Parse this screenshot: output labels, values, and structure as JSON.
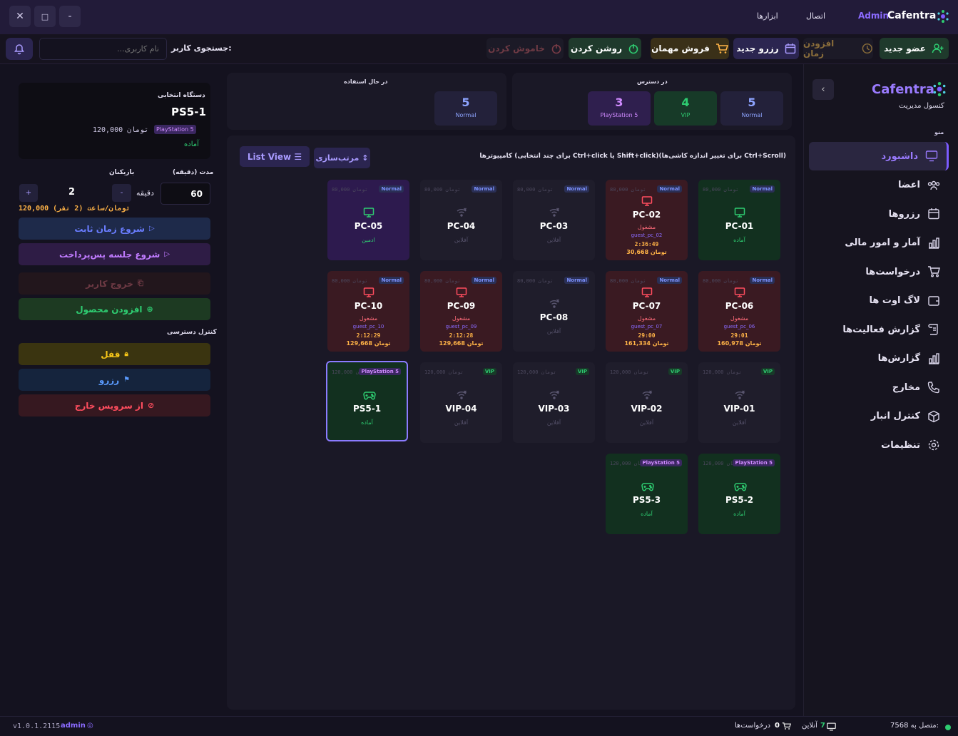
{
  "titlebar": {
    "brand": "Cafentra",
    "brand_admin": "Admin",
    "menu_connect": "اتصال",
    "menu_tools": "ابزارها",
    "btn_min": "-",
    "btn_max": "□",
    "btn_close": "✕"
  },
  "toolbar": {
    "new_member": "عضو جدید",
    "add_time": "افزودن زمان",
    "new_reserve": "رزرو جدید",
    "guest_sale": "فروش مهمان",
    "turn_on": "روشن کردن",
    "turn_off": "خاموش کردن",
    "search_label": "جستجوی کاربر:",
    "search_placeholder": "نام کاربری..."
  },
  "sidebar": {
    "brand": "Cafentra",
    "subtitle": "کنسول مدیریت",
    "menu_title": "منو",
    "collapse": "‹",
    "items": [
      {
        "label": "داشبورد",
        "icon": "monitor-icon"
      },
      {
        "label": "اعضا",
        "icon": "users-icon"
      },
      {
        "label": "رزروها",
        "icon": "calendar-icon"
      },
      {
        "label": "آمار و امور مالی",
        "icon": "chart-icon"
      },
      {
        "label": "درخواست‌ها",
        "icon": "cart-icon"
      },
      {
        "label": "لاگ اوت ها",
        "icon": "wallet-icon"
      },
      {
        "label": "گزارش فعالیت‌ها",
        "icon": "scroll-icon"
      },
      {
        "label": "گزارش‌ها",
        "icon": "bar-chart-icon"
      },
      {
        "label": "مخارج",
        "icon": "phone-icon"
      },
      {
        "label": "کنترل انبار",
        "icon": "box-icon"
      },
      {
        "label": "تنظیمات",
        "icon": "gear-icon"
      }
    ]
  },
  "stats": {
    "available_title": "در دسترس",
    "inuse_title": "در حال استفاده",
    "available": [
      {
        "n": "5",
        "l": "Normal"
      },
      {
        "n": "4",
        "l": "VIP"
      },
      {
        "n": "3",
        "l": "PlayStation 5"
      }
    ],
    "inuse": [
      {
        "n": "5",
        "l": "Normal"
      }
    ]
  },
  "grid": {
    "hint": "کامپیوترها (برای چند انتخابی Ctrl+click یا Shift+click)(برای تغییر اندازه کاشی‌ها Ctrl+Scroll)",
    "sort": "مرتب‌سازی",
    "list_view": "List View"
  },
  "tiles": [
    {
      "name": "PC-01",
      "price": "80,000 تومان",
      "badge": "Normal",
      "status": "آماده",
      "kind": "ready"
    },
    {
      "name": "PC-02",
      "price": "80,000 تومان",
      "badge": "Normal",
      "status": "مشغول",
      "user": "guest_pc_02",
      "time": "2:36:49",
      "cost": "30,668 تومان",
      "kind": "busy"
    },
    {
      "name": "PC-03",
      "price": "80,000 تومان",
      "badge": "Normal",
      "status": "آفلاین",
      "kind": "offline"
    },
    {
      "name": "PC-04",
      "price": "80,000 تومان",
      "badge": "Normal",
      "status": "آفلاین",
      "kind": "offline"
    },
    {
      "name": "PC-05",
      "price": "80,000 تومان",
      "badge": "Normal",
      "status": "ادمین",
      "kind": "admin"
    },
    {
      "name": "PC-06",
      "price": "80,000 تومان",
      "badge": "Normal",
      "status": "مشغول",
      "user": "guest_pc_06",
      "time": "29:01",
      "cost": "160,978 تومان",
      "kind": "busy"
    },
    {
      "name": "PC-07",
      "price": "80,000 تومان",
      "badge": "Normal",
      "status": "مشغول",
      "user": "guest_pc_07",
      "time": "29:00",
      "cost": "161,334 تومان",
      "kind": "busy"
    },
    {
      "name": "PC-08",
      "price": "80,000 تومان",
      "badge": "Normal",
      "status": "آفلاین",
      "kind": "offline"
    },
    {
      "name": "PC-09",
      "price": "80,000 تومان",
      "badge": "Normal",
      "status": "مشغول",
      "user": "guest_pc_09",
      "time": "2:12:28",
      "cost": "129,668 تومان",
      "kind": "busy"
    },
    {
      "name": "PC-10",
      "price": "80,000 تومان",
      "badge": "Normal",
      "status": "مشغول",
      "user": "guest_pc_10",
      "time": "2:12:29",
      "cost": "129,668 تومان",
      "kind": "busy"
    },
    {
      "name": "VIP-01",
      "price": "120,000 تومان",
      "badge": "VIP",
      "status": "آفلاین",
      "kind": "offline"
    },
    {
      "name": "VIP-02",
      "price": "120,000 تومان",
      "badge": "VIP",
      "status": "آفلاین",
      "kind": "offline"
    },
    {
      "name": "VIP-03",
      "price": "120,000 تومان",
      "badge": "VIP",
      "status": "آفلاین",
      "kind": "offline"
    },
    {
      "name": "VIP-04",
      "price": "120,000 تومان",
      "badge": "VIP",
      "status": "آفلاین",
      "kind": "offline"
    },
    {
      "name": "PS5-1",
      "price": "120,000 تومان",
      "badge": "PlayStation 5",
      "status": "آماده",
      "kind": "selected"
    },
    {
      "name": "PS5-2",
      "price": "120,000 تومان",
      "badge": "PlayStation 5",
      "status": "آماده",
      "kind": "ready"
    },
    {
      "name": "PS5-3",
      "price": "120,000 تومان",
      "badge": "PlayStation 5",
      "status": "آماده",
      "kind": "ready"
    }
  ],
  "details": {
    "title": "دستگاه انتخابی",
    "device": "PS5-1",
    "badge": "PlayStation 5",
    "price": "120,000 تومان",
    "status": "آماده",
    "duration_label": "مدت (دقیقه)",
    "duration_value": "60",
    "minute_label": "دقیقه",
    "players_label": "بازیکنان",
    "players_value": "2",
    "minus": "-",
    "plus": "+",
    "rate": "120,000 تومان/ساعت (2 نفر)",
    "start_fixed": "شروع زمان ثابت",
    "start_postpaid": "شروع جلسه پس‌پرداخت",
    "logout_user": "خروج کاربر",
    "add_product": "افزودن محصول",
    "access_title": "کنترل دسترسی",
    "lock": "قفل",
    "reserve": "رزرو",
    "out_of_service": "از سرویس خارج"
  },
  "statusbar": {
    "connected": "متصل به 7568:",
    "online_count": "7",
    "online_label": "آنلاین",
    "requests_count": "0",
    "requests_label": "درخواست‌ها",
    "user": "admin",
    "version": "v1.0.1.2115"
  },
  "colors": {
    "accent": "#7c5cff",
    "green": "#2ecc71",
    "red": "#ff4d5e",
    "orange": "#ffb347",
    "yellow": "#f5c518"
  }
}
